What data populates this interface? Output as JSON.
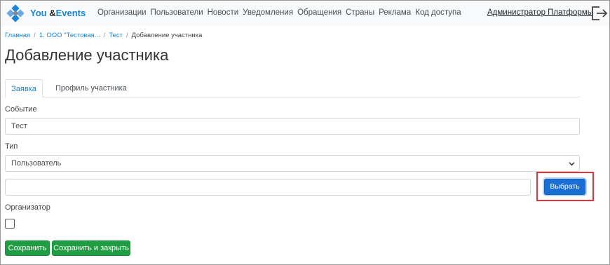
{
  "brand": {
    "name": "You",
    "amp": "&",
    "suffix": "Events"
  },
  "nav": {
    "links": [
      "Организации",
      "Пользователи",
      "Новости",
      "Уведомления",
      "Обращения",
      "Страны",
      "Реклама",
      "Код доступа"
    ],
    "admin": "Администратор Платформы",
    "logout_icon": "logout-icon"
  },
  "breadcrumb": {
    "items": [
      "Главная",
      "1. ООО \"Тестовая...",
      "Тест"
    ],
    "current": "Добавление участника"
  },
  "page_title": "Добавление участника",
  "tabs": {
    "active": "Заявка",
    "inactive": "Профиль участника"
  },
  "form": {
    "event_label": "Событие",
    "event_value": "Тест",
    "type_label": "Тип",
    "type_value": "Пользователь",
    "select_button": "Выбрать",
    "organizer_label": "Организатор",
    "save": "Сохранить",
    "save_close": "Сохранить и закрыть"
  },
  "colors": {
    "accent": "#1a85d6",
    "primary": "#1a6fd4",
    "success": "#1f9d42",
    "highlight": "#e8303a"
  }
}
